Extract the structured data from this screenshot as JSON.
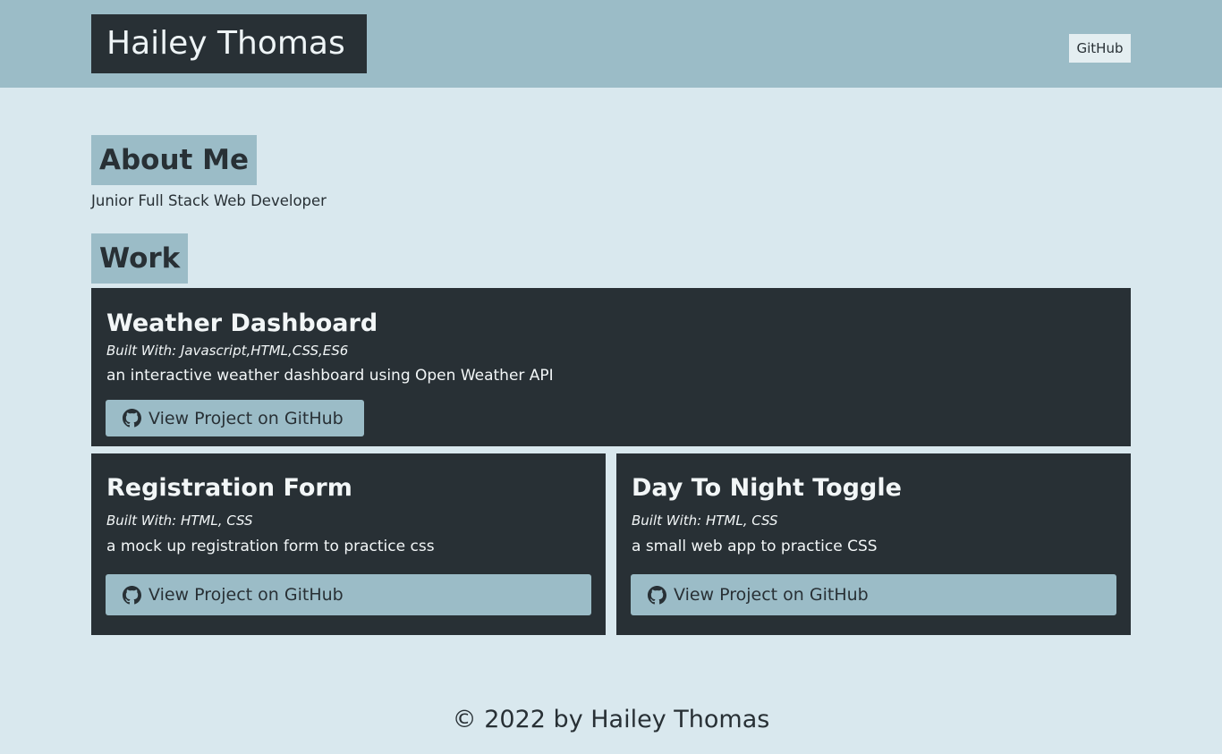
{
  "header": {
    "brand": "Hailey Thomas",
    "nav_github": "GitHub"
  },
  "about": {
    "title": "About Me",
    "text": "Junior Full Stack Web Developer"
  },
  "work": {
    "title": "Work",
    "projects": [
      {
        "title": "Weather Dashboard",
        "built_with": "Built With: Javascript,HTML,CSS,ES6",
        "description": "an interactive weather dashboard using Open Weather API",
        "button": "View Project on GitHub"
      },
      {
        "title": "Registration Form",
        "built_with": "Built With: HTML, CSS",
        "description": "a mock up registration form to practice css",
        "button": "View Project on GitHub"
      },
      {
        "title": "Day To Night Toggle",
        "built_with": "Built With: HTML, CSS",
        "description": "a small web app to practice CSS",
        "button": "View Project on GitHub"
      }
    ]
  },
  "footer": {
    "text": "© 2022 by Hailey Thomas"
  },
  "icons": {
    "github": "github-icon"
  },
  "colors": {
    "header_bg": "#9bbcc7",
    "page_bg": "#d9e8ee",
    "card_bg": "#283035",
    "button_bg": "#9bbcc7"
  }
}
